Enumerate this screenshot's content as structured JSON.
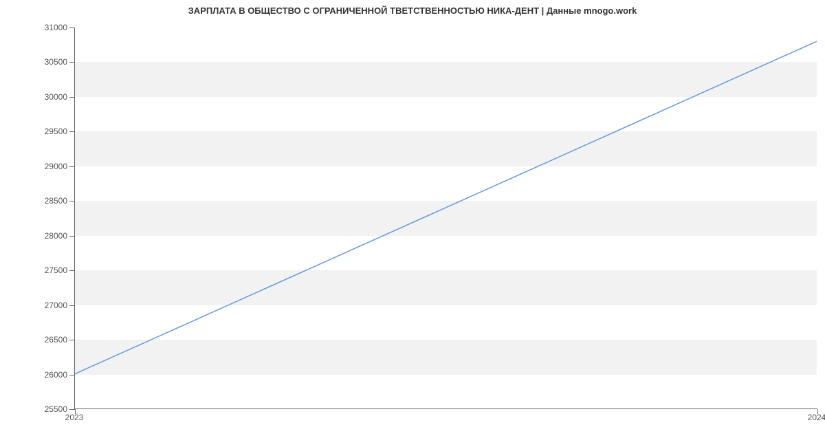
{
  "chart_data": {
    "type": "line",
    "title": "ЗАРПЛАТА В ОБЩЕСТВО С ОГРАНИЧЕННОЙ ТВЕТСТВЕННОСТЬЮ НИКА-ДЕНТ | Данные mnogo.work",
    "xlabel": "",
    "ylabel": "",
    "x": [
      2023,
      2024
    ],
    "values": [
      26000,
      30800
    ],
    "xlim": [
      2023,
      2024
    ],
    "ylim": [
      25500,
      31000
    ],
    "x_ticks": [
      2023,
      2024
    ],
    "y_ticks": [
      25500,
      26000,
      26500,
      27000,
      27500,
      28000,
      28500,
      29000,
      29500,
      30000,
      30500,
      31000
    ],
    "line_color": "#6699e0"
  }
}
